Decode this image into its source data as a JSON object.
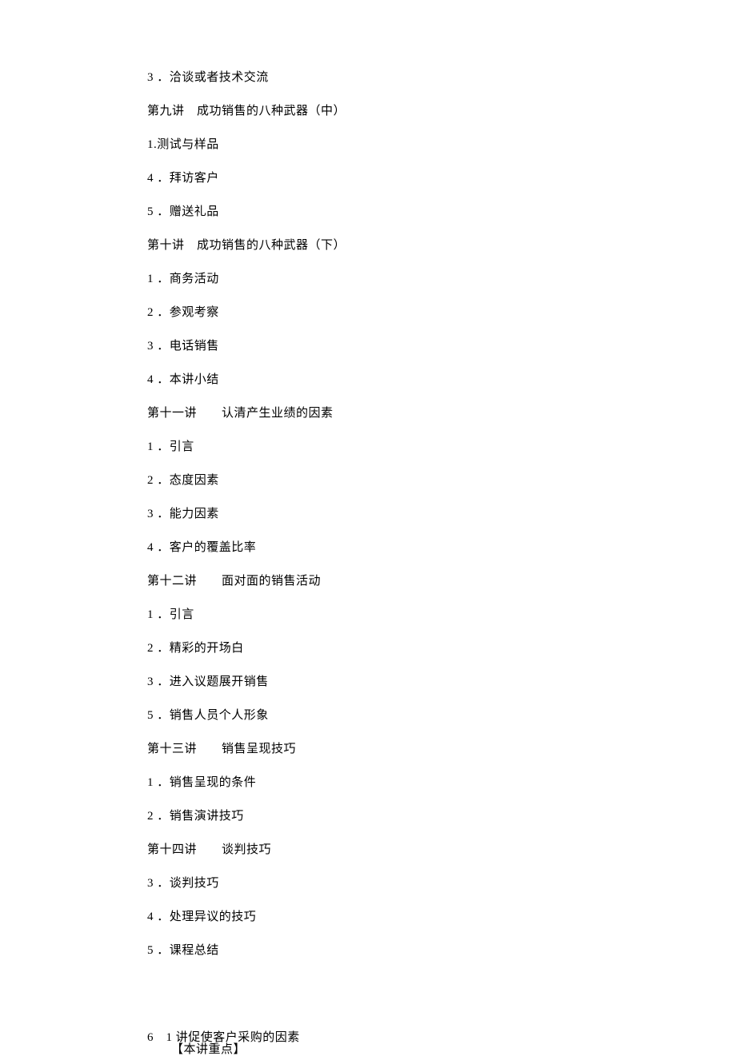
{
  "lines": {
    "l1": "3 ．洽谈或者技术交流",
    "l2": "第九讲　成功销售的八种武器（中）",
    "l3": "1.测试与样品",
    "l4": "4 ．拜访客户",
    "l5": "5 ．赠送礼品",
    "l6": "第十讲　成功销售的八种武器（下）",
    "l7": "1 ．商务活动",
    "l8": "2 ．参观考察",
    "l9": "3 ．电话销售",
    "l10": "4 ．本讲小结",
    "l11": "第十一讲　　认清产生业绩的因素",
    "l12": "1 ．引言",
    "l13": "2 ．态度因素",
    "l14": "3 ．能力因素",
    "l15": "4 ．客户的覆盖比率",
    "l16": "第十二讲　　面对面的销售活动",
    "l17": "1 ．引言",
    "l18": "2 ．精彩的开场白",
    "l19": "3 ．进入议题展开销售",
    "l20": "5 ．销售人员个人形象",
    "l21": "第十三讲　　销售呈现技巧",
    "l22": "1 ．销售呈现的条件",
    "l23": "2 ．销售演讲技巧",
    "l24": "第十四讲　　谈判技巧",
    "l25": "3 ．谈判技巧",
    "l26": "4 ．处理异议的技巧",
    "l27": "5 ．课程总结",
    "l28": "6　1 讲促使客户采购的因素",
    "l29": "【本讲重点】"
  }
}
